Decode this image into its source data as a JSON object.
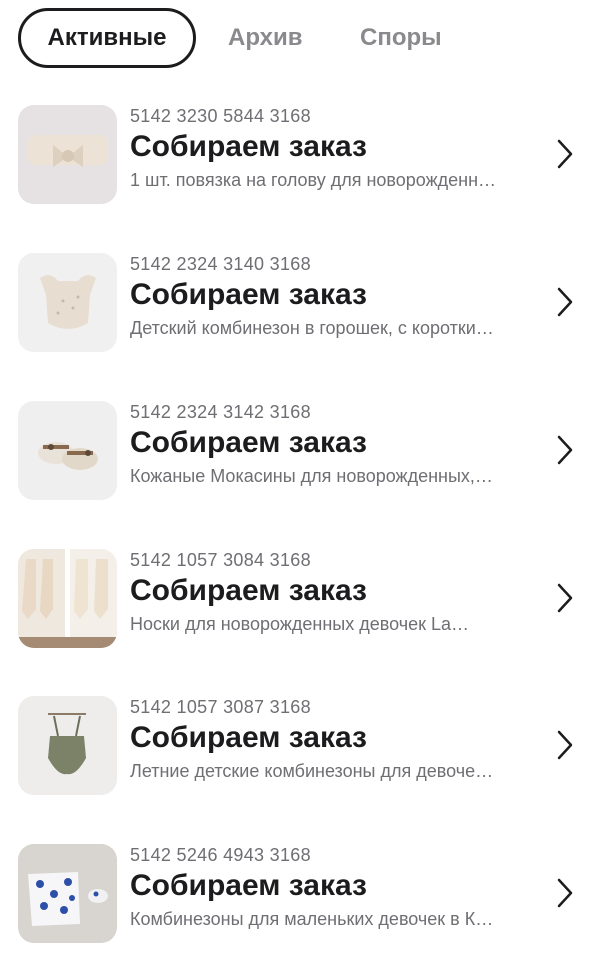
{
  "tabs": [
    {
      "label": "Активные"
    },
    {
      "label": "Архив"
    },
    {
      "label": "Споры"
    }
  ],
  "orders": [
    {
      "number": "5142 3230 5844 3168",
      "status": "Собираем заказ",
      "description": "1 шт. повязка на голову для новорожденн…",
      "image": "headband-photo"
    },
    {
      "number": "5142 2324 3140 3168",
      "status": "Собираем заказ",
      "description": "Детский комбинезон в горошек, с коротки…",
      "image": "romper-photo"
    },
    {
      "number": "5142 2324 3142 3168",
      "status": "Собираем заказ",
      "description": "Кожаные Мокасины для новорожденных,…",
      "image": "moccasins-photo"
    },
    {
      "number": "5142 1057 3084 3168",
      "status": "Собираем заказ",
      "description": "Носки для новорожденных девочек La…",
      "image": "socks-photo"
    },
    {
      "number": "5142 1057 3087 3168",
      "status": "Собираем заказ",
      "description": "Летние детские комбинезоны для девоче…",
      "image": "green-romper-photo"
    },
    {
      "number": "5142 5246 4943 3168",
      "status": "Собираем заказ",
      "description": "Комбинезоны для маленьких девочек в К…",
      "image": "floral-romper-photo"
    }
  ]
}
